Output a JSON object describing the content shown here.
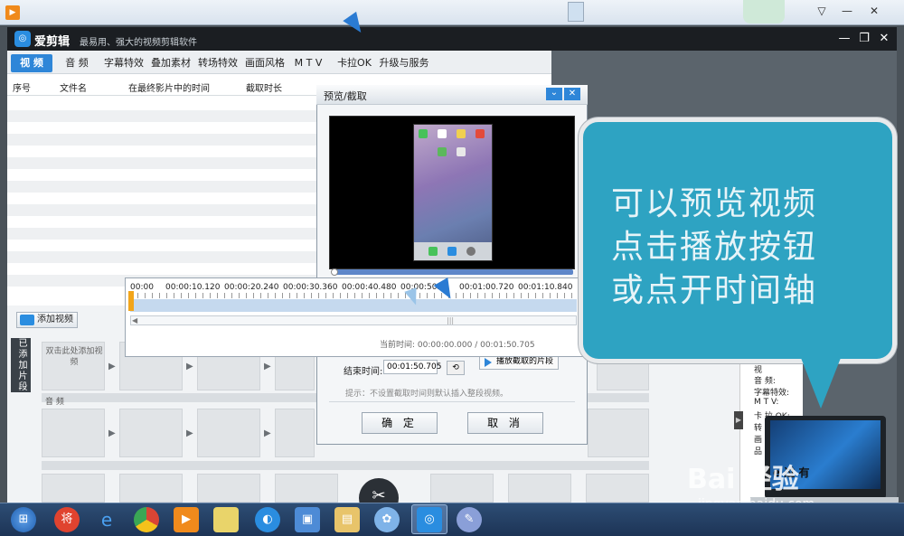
{
  "app": {
    "name": "爱剪辑",
    "slogan": "最易用、强大的视频剪辑软件",
    "logo_glyph": "◎"
  },
  "tabs": [
    "视 频",
    "音 频",
    "字幕特效",
    "叠加素材",
    "转场特效",
    "画面风格",
    "M T V",
    "卡拉OK",
    "升级与服务"
  ],
  "table": {
    "columns": [
      "序号",
      "文件名",
      "在最终影片中的时间",
      "截取时长"
    ]
  },
  "lower": {
    "add_video": "添加视频",
    "side_tag": "已添加片段",
    "slot1_text": "双击此处添加视频",
    "audio_label": "音 频",
    "right_panel": [
      "视",
      "音 频:",
      "字幕特效:",
      "M T V:",
      "卡 拉 OK:",
      "转",
      "画",
      "品"
    ]
  },
  "dialog": {
    "title": "预览/截取",
    "end_label": "结束时间:",
    "end_value": "00:01:50.705",
    "play_clip": "播放截取的片段",
    "hint": "提示：不设置截取时间则默认插入整段视频。",
    "ok": "确 定",
    "cancel": "取 消"
  },
  "timeline": {
    "ticks": [
      "00:00",
      "00:00:10.120",
      "00:00:20.240",
      "00:00:30.360",
      "00:00:40.480",
      "00:00:50.",
      "00:01:00.720",
      "00:01:10.840"
    ],
    "current_time": "当前时间: 00:00:00.000 / 00:01:50.705",
    "grip": "|||"
  },
  "bubble": {
    "lines": [
      "可以预览视频",
      "点击播放按钮",
      "或点开时间轴"
    ],
    "color": "#2ea3c2"
  },
  "watermark": {
    "brand": "Bai 经验",
    "url": "jingyan.baidu.com",
    "text": "e 过 有"
  },
  "taskbar": {
    "items": [
      "start",
      "360",
      "ie",
      "chrome",
      "media",
      "notes",
      "browser",
      "app",
      "explorer",
      "cloud",
      "aijianji",
      "paint"
    ]
  },
  "colors": {
    "accent": "#2e86d8",
    "title_bar": "#1b1e22",
    "track": "#c5d9ee"
  }
}
